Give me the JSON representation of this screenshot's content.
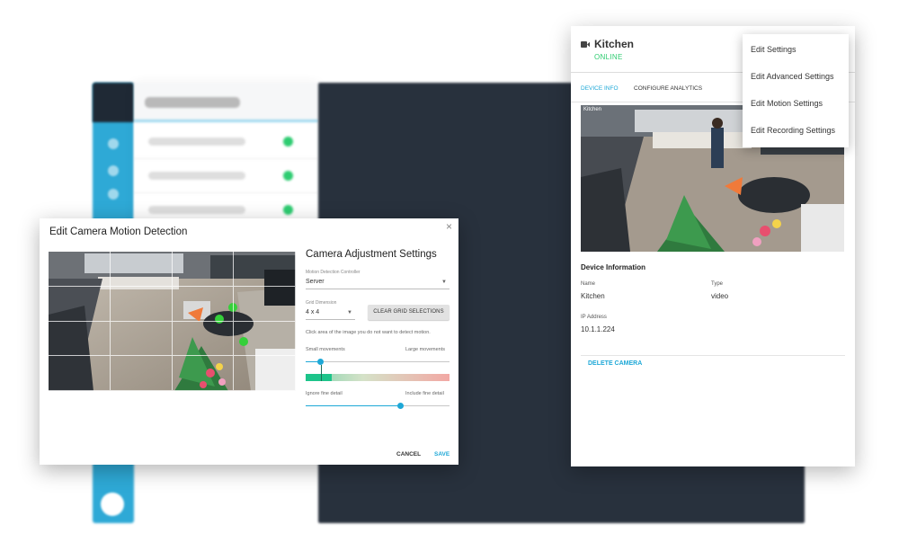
{
  "motion_dialog": {
    "title": "Edit Camera Motion Detection",
    "close_glyph": "×",
    "settings_title": "Camera Adjustment Settings",
    "controller_label": "Motion Detection Controller",
    "controller_value": "Server",
    "grid_label": "Grid Dimension",
    "grid_value": "4 x 4",
    "clear_button": "CLEAR GRID SELECTIONS",
    "hint": "Click area of the image you do not want to detect motion.",
    "sensitivity_min_label": "Small movements",
    "sensitivity_max_label": "Large movements",
    "sensitivity_value": 0.1,
    "detail_min_label": "Ignore fine detail",
    "detail_max_label": "Include fine detail",
    "detail_value": 0.66,
    "cancel": "CANCEL",
    "save": "SAVE",
    "grid_rows": 4,
    "grid_cols": 4
  },
  "device_panel": {
    "name": "Kitchen",
    "status": "ONLINE",
    "tabs": [
      "DEVICE INFO",
      "CONFIGURE ANALYTICS"
    ],
    "camera_label": "Kitchen",
    "section_title": "Device Information",
    "fields": {
      "name_label": "Name",
      "name_value": "Kitchen",
      "type_label": "Type",
      "type_value": "video",
      "ip_label": "IP Address",
      "ip_value": "10.1.1.224"
    },
    "delete_button": "DELETE CAMERA"
  },
  "context_menu": {
    "items": [
      "Edit Settings",
      "Edit Advanced Settings",
      "Edit Motion Settings",
      "Edit Recording Settings"
    ]
  },
  "colors": {
    "accent": "#1ea8d7",
    "online": "#2ecc71",
    "dark_background": "#28313d"
  }
}
